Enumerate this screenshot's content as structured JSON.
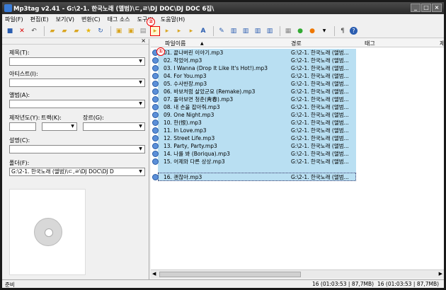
{
  "window": {
    "title": "Mp3tag v2.41  -  G:\\2-1. 한국노래 (앨범)\\ㄷ,ㄹ\\DJ DOC\\DJ DOC 6집\\"
  },
  "menu": [
    "파일(F)",
    "편집(E)",
    "보기(V)",
    "변환(C)",
    "태그 소스",
    "도구(I)",
    "도움말(H)"
  ],
  "markers": [
    "①",
    "②"
  ],
  "tag_panel": {
    "title_label": "제목(T):",
    "artist_label": "아티스트(I):",
    "album_label": "앨범(A):",
    "year_label": "제작년도(Y):",
    "track_label": "트랙(K):",
    "genre_label": "장르(G):",
    "comment_label": "설명(C):",
    "folder_label": "폴더(F):",
    "folder_value": "G:\\2-1. 한국노래 (앨범)\\ㄷ,ㄹ\\DJ DOC\\DJ D"
  },
  "file_list": {
    "columns": [
      "파일이름",
      "경로",
      "태그",
      "제"
    ],
    "path_value": "G:\\2-1. 한국노래 (앨범...",
    "files": [
      "01. 끝나버린 이야기.mp3",
      "02. 착었어.mp3",
      "03. I Wanna (Drop It Like It's Hot!).mp3",
      "04. For You.mp3",
      "05. 수사반장.mp3",
      "06. 바보처럼 살았군요 (Remake).mp3",
      "07. 돌아보면 청춘(靑春).mp3",
      "08. 내 손을 잡아줘.mp3",
      "09. One Night.mp3",
      "10. 한(恨).mp3",
      "11. In Love.mp3",
      "12. Street Life.mp3",
      "13. Party, Party.mp3",
      "14. 나를 봐 (Boriqua).mp3",
      "15. 어제와 다른 상상.mp3",
      "16. 괜찮아.mp3"
    ]
  },
  "status": {
    "left": "준비",
    "count1": "16 (01:03:53 | 87,7MB)",
    "count2": "16 (01:03:53 | 87,7MB)"
  },
  "colors": {
    "selection": "#b9dff2",
    "marker": "#e00000"
  }
}
